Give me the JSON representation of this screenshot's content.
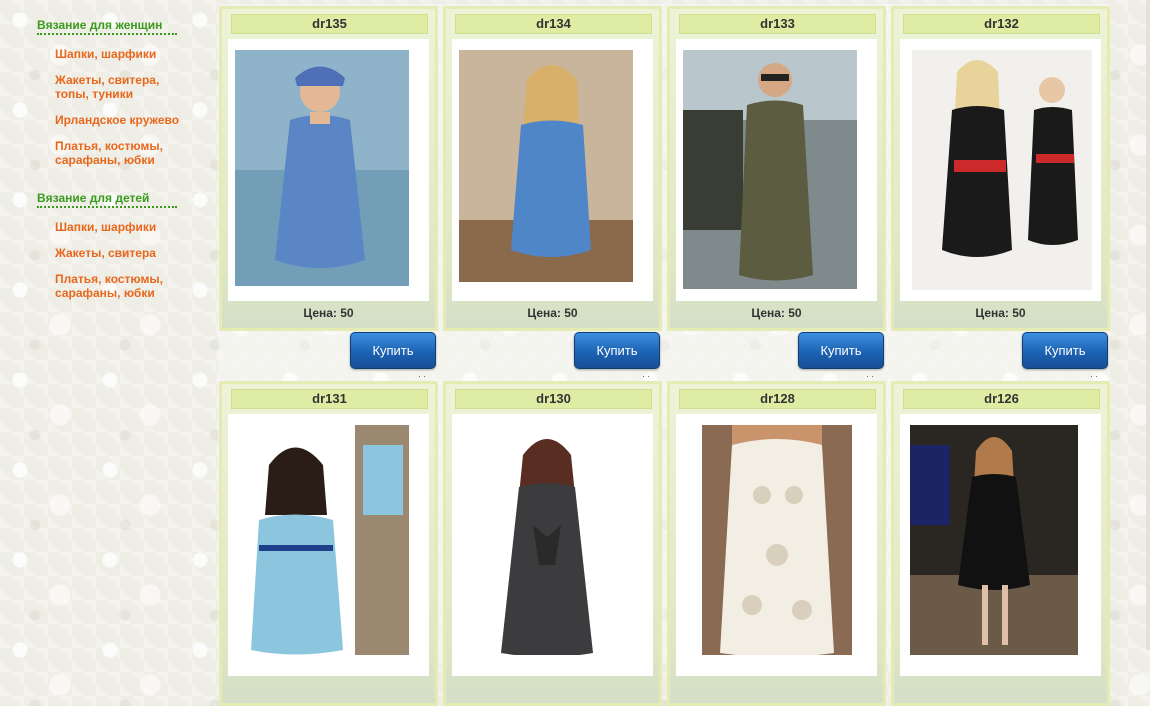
{
  "sidebar": {
    "women": {
      "heading": "Вязание для женщин",
      "items": [
        {
          "label": "Шапки, шарфики"
        },
        {
          "label": "Жакеты, свитера, топы, туники"
        },
        {
          "label": "Ирландское кружево"
        },
        {
          "label": "Платья, костюмы, сарафаны, юбки"
        }
      ]
    },
    "kids": {
      "heading": "Вязание для детей",
      "items": [
        {
          "label": "Шапки, шарфики"
        },
        {
          "label": "Жакеты, свитера"
        },
        {
          "label": "Платья, костюмы, сарафаны, юбки"
        }
      ]
    }
  },
  "products": [
    {
      "code": "dr135",
      "price": "Цена: 50",
      "buy": "Купить",
      "colors": {
        "bg": "#8fb3c9",
        "item": "#5b86c6",
        "skin": "#e3b894"
      }
    },
    {
      "code": "dr134",
      "price": "Цена: 50",
      "buy": "Купить",
      "colors": {
        "bg": "#c9b59c",
        "item": "#4f86c8",
        "skin": "#deb08c"
      }
    },
    {
      "code": "dr133",
      "price": "Цена: 50",
      "buy": "Купить",
      "colors": {
        "bg": "#7f8a8c",
        "item": "#5b5c40",
        "skin": "#d6a784"
      }
    },
    {
      "code": "dr132",
      "price": "Цена: 50",
      "buy": "Купить",
      "colors": {
        "bg": "#f2f0ec",
        "item": "#1a1a1a",
        "skin": "#e8c7a6"
      }
    },
    {
      "code": "dr131",
      "price": "",
      "buy": "",
      "colors": {
        "bg": "#9b8870",
        "item": "#8cc6de",
        "skin": "#e2b898"
      }
    },
    {
      "code": "dr130",
      "price": "",
      "buy": "",
      "colors": {
        "bg": "#ffffff",
        "item": "#3c3c3e",
        "skin": "#e4c1a4"
      }
    },
    {
      "code": "dr128",
      "price": "",
      "buy": "",
      "colors": {
        "bg": "#8a6a52",
        "item": "#f3eee4",
        "skin": "#c9936c"
      }
    },
    {
      "code": "dr126",
      "price": "",
      "buy": "",
      "colors": {
        "bg": "#2a2622",
        "item": "#111111",
        "skin": "#e0c0a8"
      }
    }
  ]
}
